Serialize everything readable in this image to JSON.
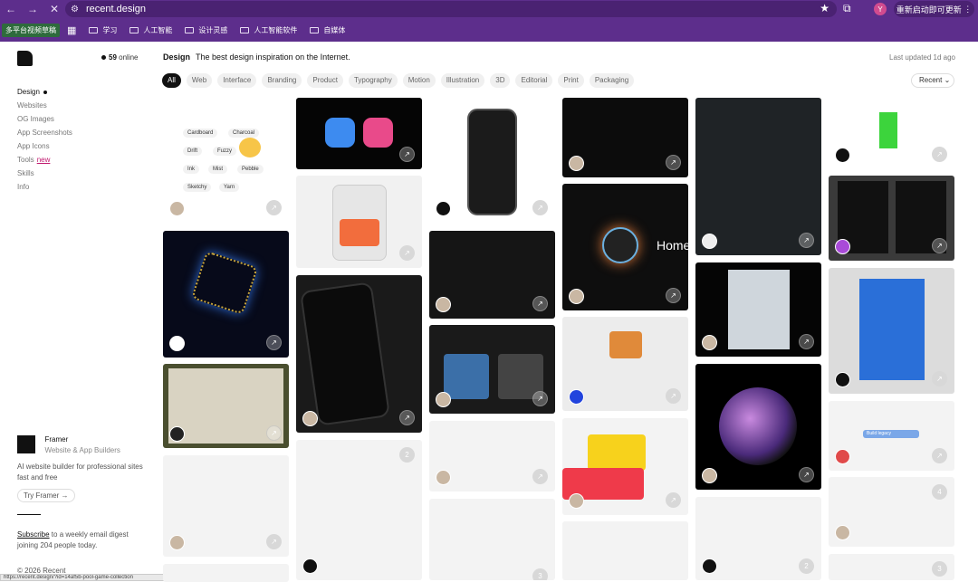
{
  "browser": {
    "url": "recent.design",
    "restart_label": "重新启动即可更新",
    "profile_initial": "Y",
    "bookmarks": [
      "多平台视频草稿",
      "学习",
      "人工智能",
      "设计灵感",
      "人工智能软件",
      "自媒体"
    ]
  },
  "sidebar": {
    "online_count": "59",
    "online_label": "online",
    "nav": [
      {
        "label": "Design",
        "active": true
      },
      {
        "label": "Websites"
      },
      {
        "label": "OG Images"
      },
      {
        "label": "App Screenshots"
      },
      {
        "label": "App Icons"
      },
      {
        "label": "Tools",
        "badge": "new"
      },
      {
        "label": "Skills"
      },
      {
        "label": "Info"
      }
    ],
    "ad": {
      "title": "Framer",
      "subtitle": "Website & App Builders",
      "description": "AI website builder for professional sites fast and free",
      "button": "Try Framer"
    },
    "subscribe_link": "Subscribe",
    "subscribe_text": " to a weekly email digest joining 204 people today.",
    "copyright": "© 2026 Recent",
    "status_url": "https://recent.design/?id=14af5b-pool-game-collection"
  },
  "header": {
    "title": "Design",
    "tagline": "The best design inspiration on the Internet.",
    "updated": "Last updated 1d ago"
  },
  "filters": [
    "All",
    "Web",
    "Interface",
    "Branding",
    "Product",
    "Typography",
    "Motion",
    "Illustration",
    "3D",
    "Editorial",
    "Print",
    "Packaging"
  ],
  "sort_label": "Recent",
  "card_text": {
    "cardboard_pills": [
      "Cardboard",
      "Charcoal",
      "Drift",
      "Fuzzy",
      "Ink",
      "Mist",
      "Pebble",
      "Sketchy",
      "Yarn"
    ],
    "home_label": "Home",
    "counts": [
      "2",
      "4",
      "3",
      "2",
      "3"
    ],
    "build_legacy": "Build legacy"
  }
}
